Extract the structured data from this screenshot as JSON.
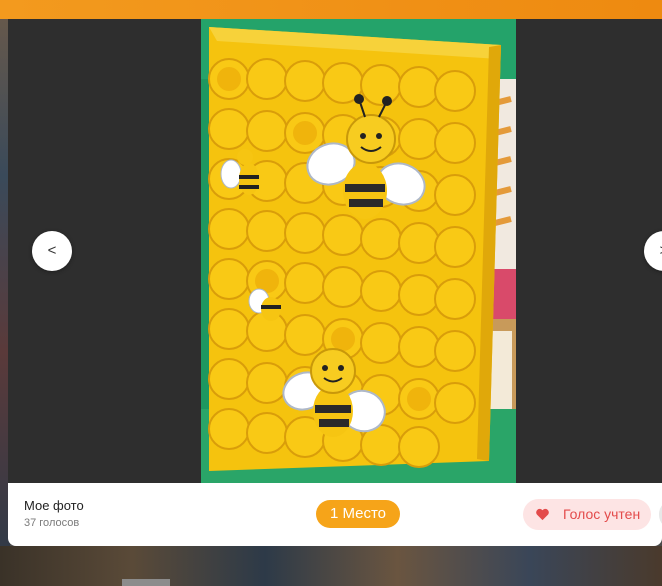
{
  "viewer": {
    "prev_label": "<",
    "next_label": ">"
  },
  "photo": {
    "subject": "yellow paper-roll honeycomb board with paper bees"
  },
  "info": {
    "author": "Мое фото",
    "votes": "37 голосов",
    "place": "1 Место",
    "vote_button": "Голос учтен"
  },
  "icons": {
    "vote": "heart-icon"
  },
  "colors": {
    "accent": "#f6a419",
    "vote_bg": "#fde4e4",
    "vote_text": "#e34b4b",
    "top_bar": "#f39a1e"
  }
}
